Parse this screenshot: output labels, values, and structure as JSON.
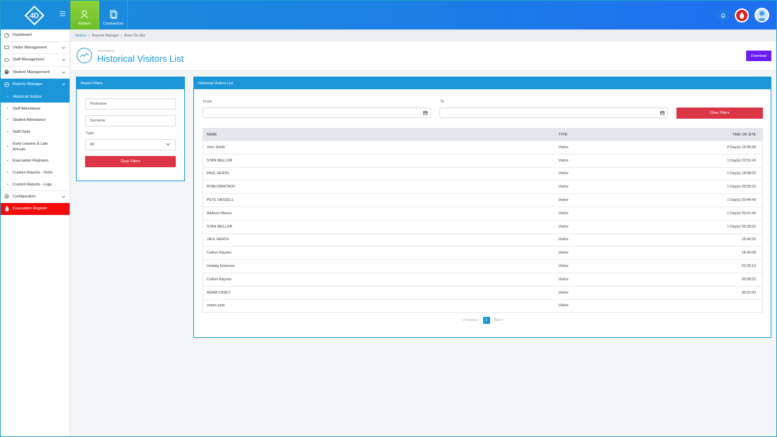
{
  "topbar": {
    "logo_text": "4D",
    "nav": [
      {
        "label": "Visitors"
      },
      {
        "label": "Contractors"
      }
    ]
  },
  "sidebar": {
    "items": [
      {
        "label": "Dashboard"
      },
      {
        "label": "Visitor Management"
      },
      {
        "label": "Staff Management"
      },
      {
        "label": "Student Management"
      },
      {
        "label": "Reports Manager"
      }
    ],
    "sub_items": [
      {
        "label": "Historical Visitors"
      },
      {
        "label": "Staff Attendance"
      },
      {
        "label": "Student Attendance"
      },
      {
        "label": "Staff Visits"
      },
      {
        "label": "Early Leavers & Late Arrivals"
      },
      {
        "label": "Evacuation Registers"
      },
      {
        "label": "Custom Reports - Visits"
      },
      {
        "label": "Custom Reports - Logs"
      }
    ],
    "configuration": "Configuration",
    "evacuation_register": "Evacuation Register"
  },
  "breadcrumb": {
    "items": [
      "Visitors",
      "Reports Manager",
      "Been On Site"
    ],
    "separator": "/"
  },
  "header": {
    "subtitle": "REPORTS",
    "title": "Historical Visitors List",
    "download_label": "Download"
  },
  "filters": {
    "title": "Report Filters",
    "firstname_placeholder": "Firstname",
    "surname_placeholder": "Surname",
    "type_label": "Type",
    "type_value": "All",
    "clear_label": "Clear Filters"
  },
  "list": {
    "title": "Historical Visitors List",
    "from_label": "From",
    "to_label": "To",
    "clear_label": "Clear Filters",
    "columns": {
      "name": "NAME",
      "type": "TYPE",
      "time": "TIME ON SITE"
    },
    "rows": [
      {
        "name": "John Smith",
        "type": "Visitor",
        "time": "4 Day(s) 19:45:58"
      },
      {
        "name": "STAN MELLOR",
        "type": "Visitor",
        "time": "1 Day(s) 22:51:43"
      },
      {
        "name": "PAUL HEATH",
        "type": "Visitor",
        "time": "1 Day(s) 18:08:53"
      },
      {
        "name": "RYAN DIMITROV",
        "type": "Visitor",
        "time": "1 Day(s) 00:55:23"
      },
      {
        "name": "PETE HASSELL",
        "type": "Visitor",
        "time": "1 Day(s) 00:44:49"
      },
      {
        "name": "Addison Munoz",
        "type": "Visitor",
        "time": "1 Day(s) 00:41:40"
      },
      {
        "name": "STAN MELLOR",
        "type": "Visitor",
        "time": "1 Day(s) 00:39:52"
      },
      {
        "name": "JAUL HEATH",
        "type": "Visitor",
        "time": "19:44:20"
      },
      {
        "name": "Callum Raynes",
        "type": "Visitor",
        "time": "19:42:08"
      },
      {
        "name": "Hedwig Emerson",
        "type": "Visitor",
        "time": "03:26:19"
      },
      {
        "name": "Callum Raynes",
        "type": "Visitor",
        "time": "00:08:52"
      },
      {
        "name": "ADAM CASEY",
        "type": "Visitor",
        "time": "00:01:03"
      },
      {
        "name": "marko polo",
        "type": "Visitor",
        "time": ""
      }
    ],
    "pagination": {
      "prev": "« Previous",
      "page": "1",
      "next": "Next »"
    }
  }
}
